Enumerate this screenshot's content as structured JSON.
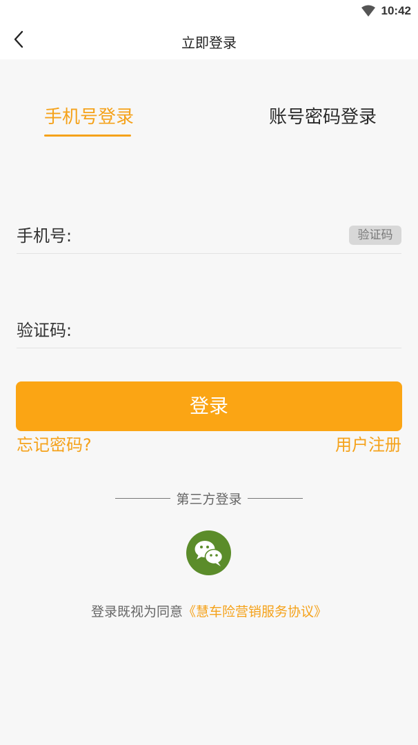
{
  "status_bar": {
    "time": "10:42"
  },
  "header": {
    "title": "立即登录"
  },
  "tabs": [
    {
      "label": "手机号登录",
      "active": true
    },
    {
      "label": "账号密码登录",
      "active": false
    }
  ],
  "form": {
    "phone_label": "手机号:",
    "phone_value": "",
    "code_label": "验证码:",
    "code_value": "",
    "get_code_label": "验证码"
  },
  "login_button": "登录",
  "forgot_password": "忘记密码?",
  "register": "用户注册",
  "third_party_label": "第三方登录",
  "agreement": {
    "prefix": "登录既视为同意",
    "link": "《慧车险营销服务协议》"
  },
  "colors": {
    "accent": "#f5a21a",
    "button": "#fba514",
    "wechat": "#5b8c2a"
  },
  "icons": [
    "wifi-icon",
    "back-arrow-icon",
    "wechat-icon"
  ]
}
